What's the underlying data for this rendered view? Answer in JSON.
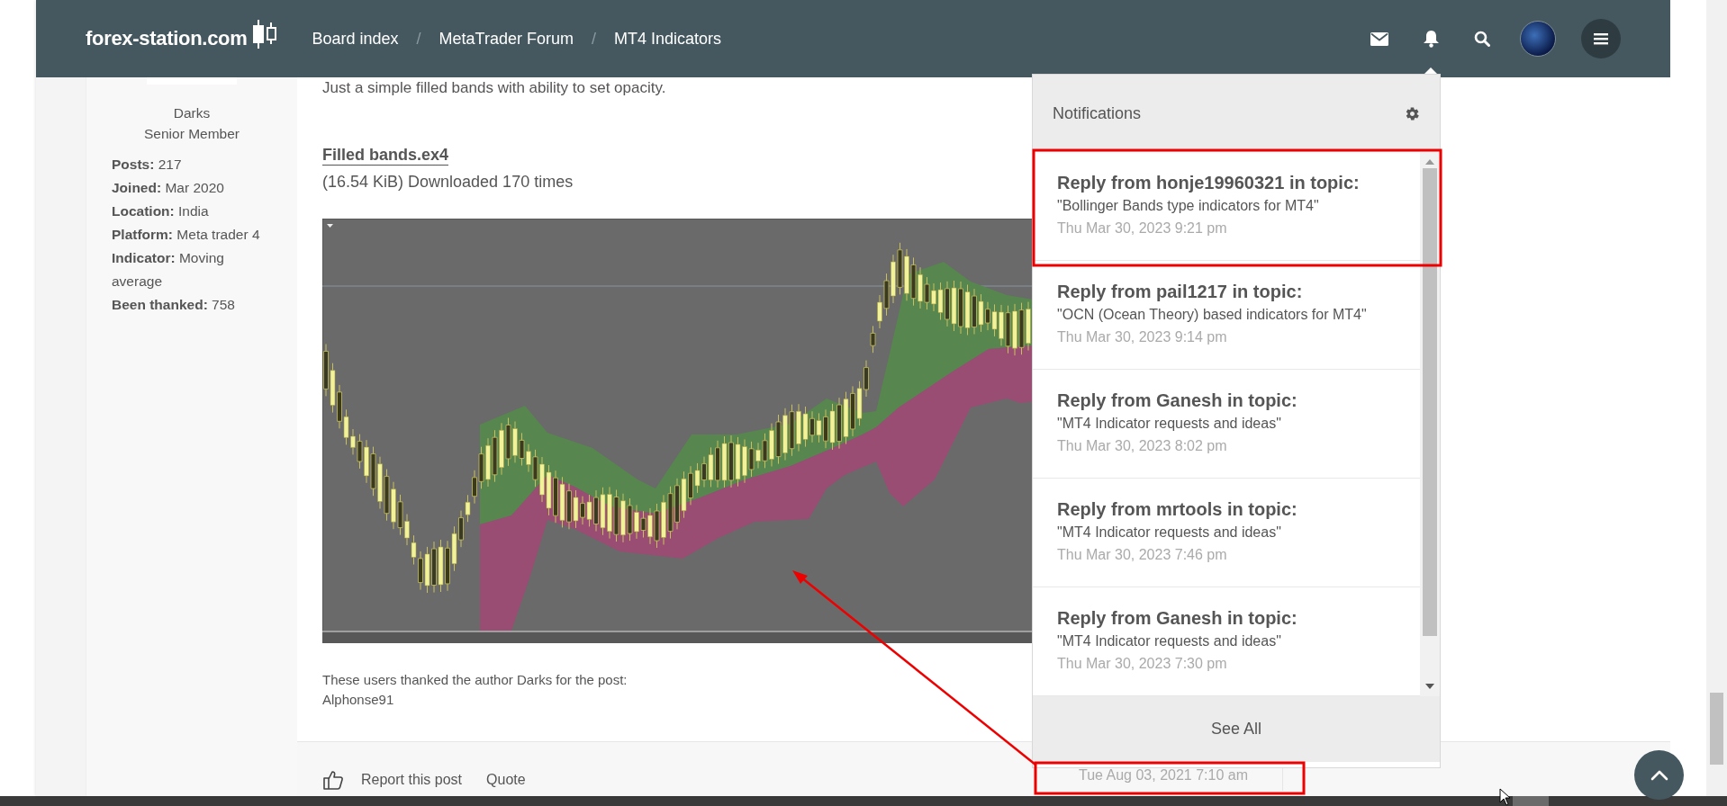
{
  "header": {
    "logo": "forex-station.com",
    "breadcrumbs": [
      "Board index",
      "MetaTrader Forum",
      "MT4 Indicators"
    ],
    "separators": [
      "/",
      "/"
    ]
  },
  "profile": {
    "username": "Darks",
    "rank": "Senior Member",
    "fields": [
      {
        "label": "Posts:",
        "value": "217"
      },
      {
        "label": "Joined:",
        "value": "Mar 2020"
      },
      {
        "label": "Location:",
        "value": "India"
      },
      {
        "label": "Platform:",
        "value": "Meta trader 4"
      },
      {
        "label": "Indicator:",
        "value": "Moving average"
      },
      {
        "label": "Been thanked:",
        "value": "758"
      }
    ]
  },
  "post": {
    "intro": "Just a simple filled bands with ability to set opacity.",
    "attachment": {
      "name": "Filled bands.ex4",
      "info": "(16.54 KiB) Downloaded 170 times"
    },
    "thanks": "These users thanked the author Darks for the post:",
    "thanked_users": [
      "Alphonse91"
    ],
    "actions": [
      "Report this post",
      "Quote"
    ],
    "date": "Tue Aug 03, 2021 7:10 am",
    "date_highlighted": true
  },
  "notifications": {
    "title": "Notifications",
    "items": [
      {
        "title": "**Reply** from honje19960321 in topic:",
        "topic": "\"Bollinger Bands type indicators for MT4\"",
        "time": "Thu Mar 30, 2023 9:21 pm",
        "highlighted": true
      },
      {
        "title": "**Reply** from pail1217 in topic:",
        "topic": "\"OCN (Ocean Theory) based indicators for MT4\"",
        "time": "Thu Mar 30, 2023 9:14 pm",
        "highlighted": false
      },
      {
        "title": "**Reply** from Ganesh in topic:",
        "topic": "\"MT4 Indicator requests and ideas\"",
        "time": "Thu Mar 30, 2023 8:02 pm",
        "highlighted": false
      },
      {
        "title": "**Reply** from mrtools in topic:",
        "topic": "\"MT4 Indicator requests and ideas\"",
        "time": "Thu Mar 30, 2023 7:46 pm",
        "highlighted": false
      },
      {
        "title": "**Reply** from Ganesh in topic:",
        "topic": "\"MT4 Indicator requests and ideas\"",
        "time": "Thu Mar 30, 2023 7:30 pm",
        "highlighted": false
      }
    ],
    "footer": "See All"
  }
}
